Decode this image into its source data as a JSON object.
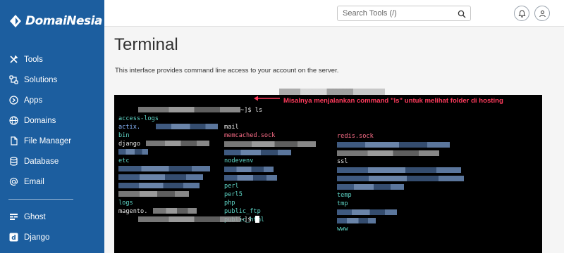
{
  "brand": {
    "name": "DomaiNesia"
  },
  "sidebar": {
    "items": [
      {
        "label": "Tools",
        "icon": "tools-icon"
      },
      {
        "label": "Solutions",
        "icon": "solutions-icon"
      },
      {
        "label": "Apps",
        "icon": "apps-icon"
      },
      {
        "label": "Domains",
        "icon": "globe-icon"
      },
      {
        "label": "File Manager",
        "icon": "file-icon"
      },
      {
        "label": "Database",
        "icon": "database-icon"
      },
      {
        "label": "Email",
        "icon": "email-icon"
      }
    ],
    "secondary": [
      {
        "label": "Ghost",
        "icon": "ghost-icon"
      },
      {
        "label": "Django",
        "icon": "django-icon"
      }
    ]
  },
  "header": {
    "search_placeholder": "Search Tools (/)"
  },
  "main": {
    "title": "Terminal",
    "description": "This interface provides command line access to your account on the server."
  },
  "terminal": {
    "prompt_suffix": "~]$",
    "command": "ls",
    "annotation": "Misalnya menjalankan command \"ls\" untuk melihat folder di hosting",
    "col1": [
      "access-logs",
      "actix.",
      "bin",
      "django",
      "",
      "etc",
      "",
      "",
      "",
      "logs",
      "magento."
    ],
    "col2": [
      "mail",
      "memcached.sock",
      "",
      "",
      "nodevenv",
      "",
      "",
      "perl",
      "perl5",
      "php",
      "public_ftp",
      "public_html"
    ],
    "col3": [
      "redis.sock",
      "",
      "ssl",
      "",
      "",
      "",
      "",
      "temp",
      "tmp",
      "",
      "",
      "www"
    ]
  },
  "colors": {
    "sidebar_bg": "#1c5e9f",
    "terminal_bg": "#000000",
    "dir_color": "#5fd7c8",
    "file_color": "#8ab8ff",
    "socket_color": "#ff6f8a",
    "annotation_color": "#ff3b5c"
  }
}
